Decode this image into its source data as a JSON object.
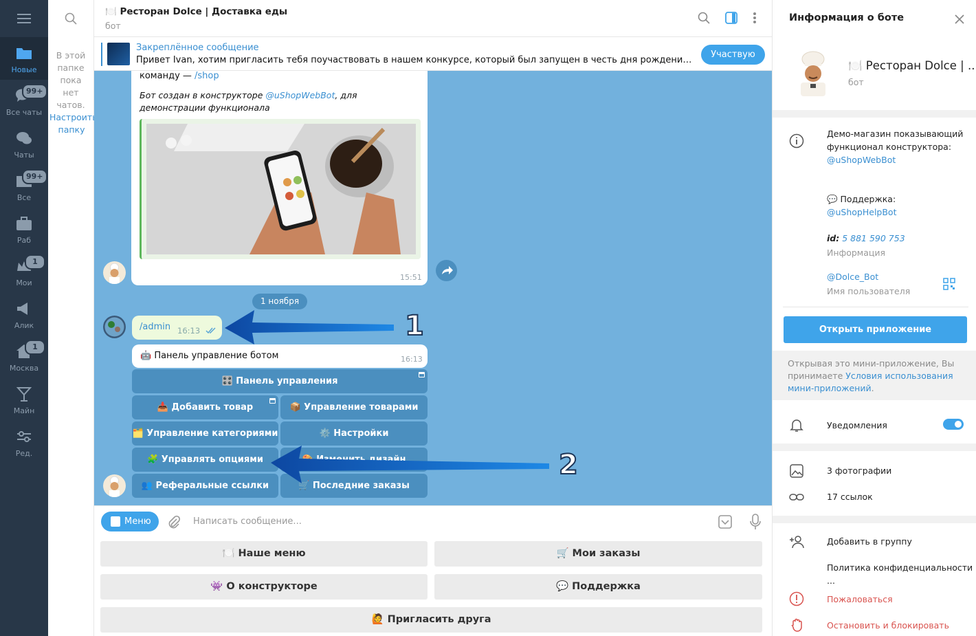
{
  "folders": [
    {
      "label": "Новые",
      "icon": "folder-icon",
      "badge": ""
    },
    {
      "label": "Все чаты",
      "icon": "chats-icon",
      "badge": "99+"
    },
    {
      "label": "Чаты",
      "icon": "chat-bubbles-icon",
      "badge": ""
    },
    {
      "label": "Все",
      "icon": "folder-icon",
      "badge": "99+"
    },
    {
      "label": "Раб",
      "icon": "briefcase-icon",
      "badge": ""
    },
    {
      "label": "Мои",
      "icon": "crown-icon",
      "badge": "1"
    },
    {
      "label": "Алик",
      "icon": "megaphone-icon",
      "badge": ""
    },
    {
      "label": "Москва",
      "icon": "home-icon",
      "badge": "1"
    },
    {
      "label": "Майн",
      "icon": "cocktail-icon",
      "badge": ""
    },
    {
      "label": "Ред.",
      "icon": "sliders-icon",
      "badge": ""
    }
  ],
  "chatlist": {
    "empty_text": "В этой папке пока нет чатов.",
    "setup_link": "Настроить папку"
  },
  "header": {
    "title": "🍽️ Ресторан Dolce | Доставка еды",
    "subtitle": "бот"
  },
  "pinned": {
    "title": "Закреплённое сообщение",
    "text": "Привет Ivan, хотим пригласить тебя поучаствовать в нашем конкурсе, который был запущен в честь дня рождения конст…",
    "join_label": "Участвую"
  },
  "messages": {
    "m1_line1": "команду — ",
    "m1_link": "/shop",
    "m1_italic_a": "Бот создан в конструкторе ",
    "m1_italic_link": "@uShopWebBot",
    "m1_italic_b": ", для демонстрации функционала",
    "m1_time": "15:51",
    "date_pill": "1 ноября",
    "admin_text": "/admin",
    "admin_time": "16:13",
    "panel_text": "🤖 Панель управление ботом",
    "panel_time": "16:13"
  },
  "inline_buttons": {
    "b1": "🎛️ Панель управления",
    "b2": "📥 Добавить товар",
    "b3": "📦 Управление товарами",
    "b4": "🗂️ Управление категориями",
    "b5": "⚙️ Настройки",
    "b6": "🧩 Управлять опциями",
    "b7": "🎨 Изменить дизайн",
    "b8": "👥 Реферальные ссылки",
    "b9": "🛒 Последние заказы"
  },
  "annotations": {
    "n1": "1",
    "n2": "2"
  },
  "composer": {
    "menu_label": "Меню",
    "placeholder": "Написать сообщение..."
  },
  "keyboard": {
    "k1": "🍽️ Наше меню",
    "k2": "🛒 Мои заказы",
    "k3": "👾 О конструкторе",
    "k4": "💬 Поддержка",
    "k5": "🙋 Пригласить друга"
  },
  "info": {
    "title": "Информация о боте",
    "bot_name": "🍽️ Ресторан Dolce | ...",
    "bot_sub": "бот",
    "desc_a": "Демо-магазин показывающий функционал конструктора:",
    "desc_link": "@uShopWebBot",
    "support_a": "💬 Поддержка:",
    "support_link": "@uShopHelpBot",
    "id_label": "id:",
    "id_value": "5 881 590 753",
    "id_sub": "Информация",
    "username": "@Dolce_Bot",
    "username_sub": "Имя пользователя",
    "open_app": "Открыть приложение",
    "disclaimer_a": "Открывая это мини-приложение, Вы принимаете ",
    "disclaimer_link": "Условия использования мини-приложений",
    "disclaimer_b": ".",
    "notifications": "Уведомления",
    "photos": "3 фотографии",
    "links": "17 ссылок",
    "add_group": "Добавить в группу",
    "privacy": "Политика конфиденциальности ...",
    "report": "Пожаловаться",
    "block": "Остановить и блокировать"
  },
  "colors": {
    "rail": "#283748",
    "accent": "#3fa4ea",
    "chat_bg": "#72b1dd",
    "inline_btn": "#4b8fbf",
    "danger": "#d9534f"
  }
}
